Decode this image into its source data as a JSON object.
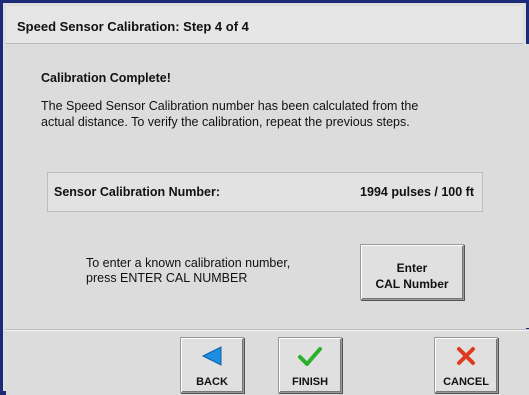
{
  "window": {
    "title": "Speed Sensor Calibration: Step 4 of 4"
  },
  "main": {
    "heading": "Calibration Complete!",
    "description_line1": "The Speed Sensor Calibration number has been calculated from the",
    "description_line2": "actual distance.  To verify the calibration, repeat the previous steps.",
    "result": {
      "label": "Sensor Calibration Number:",
      "value": "1994 pulses / 100 ft"
    },
    "instruction_line1": "To enter a known calibration number,",
    "instruction_line2": "press ENTER CAL NUMBER",
    "enter_cal_button": {
      "line1": "Enter",
      "line2": "CAL Number"
    }
  },
  "footer": {
    "back": {
      "label": "BACK",
      "icon": "left-arrow-icon",
      "color": "#1e8fe0"
    },
    "finish": {
      "label": "FINISH",
      "icon": "check-icon",
      "color": "#2bb02b"
    },
    "cancel": {
      "label": "CANCEL",
      "icon": "x-icon",
      "color": "#e03a1e"
    }
  }
}
